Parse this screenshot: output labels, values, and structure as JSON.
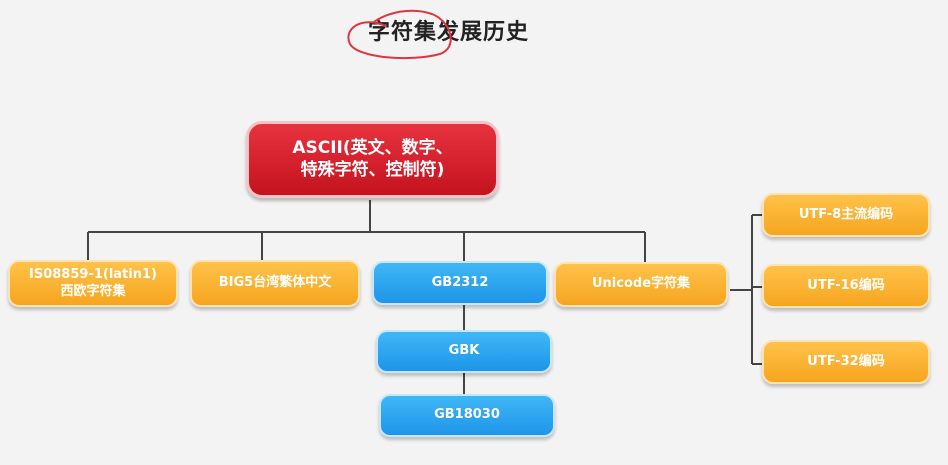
{
  "title": "字符集发展历史",
  "colors": {
    "root": "#d41f2c",
    "orange": "#f8b133",
    "blue": "#2aa4ef",
    "connector": "#444444",
    "annotation": "#e0353f"
  },
  "root": {
    "line1": "ASCII(英文、数字、",
    "line2": "特殊字符、控制符)"
  },
  "level1": [
    {
      "line1": "IS08859-1(latin1)",
      "line2": "西欧字符集"
    },
    {
      "label": "BIG5台湾繁体中文"
    },
    {
      "label": "GB2312"
    },
    {
      "label": "Unicode字符集"
    }
  ],
  "gb_chain": [
    "GBK",
    "GB18030"
  ],
  "unicode_children": [
    "UTF-8主流编码",
    "UTF-16编码",
    "UTF-32编码"
  ]
}
